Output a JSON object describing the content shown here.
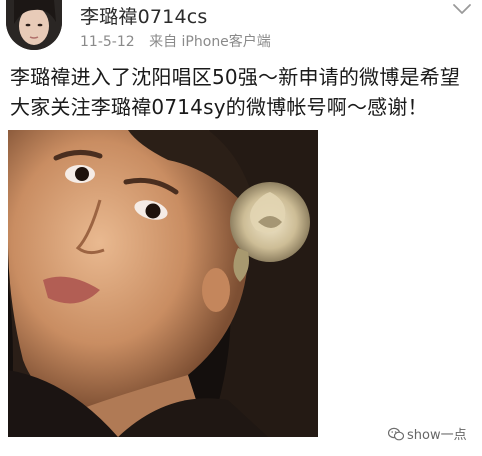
{
  "post": {
    "username": "李璐禕0714cs",
    "date": "11-5-12",
    "source": "来自 iPhone客户端",
    "text": "李璐禕进入了沈阳唱区50强～新申请的微博是希望大家关注李璐禕0714sy的微博帐号啊～感谢！"
  },
  "watermark": {
    "text": "show一点",
    "icon": "wechat-icon"
  },
  "icons": {
    "menu": "chevron-down-icon"
  }
}
